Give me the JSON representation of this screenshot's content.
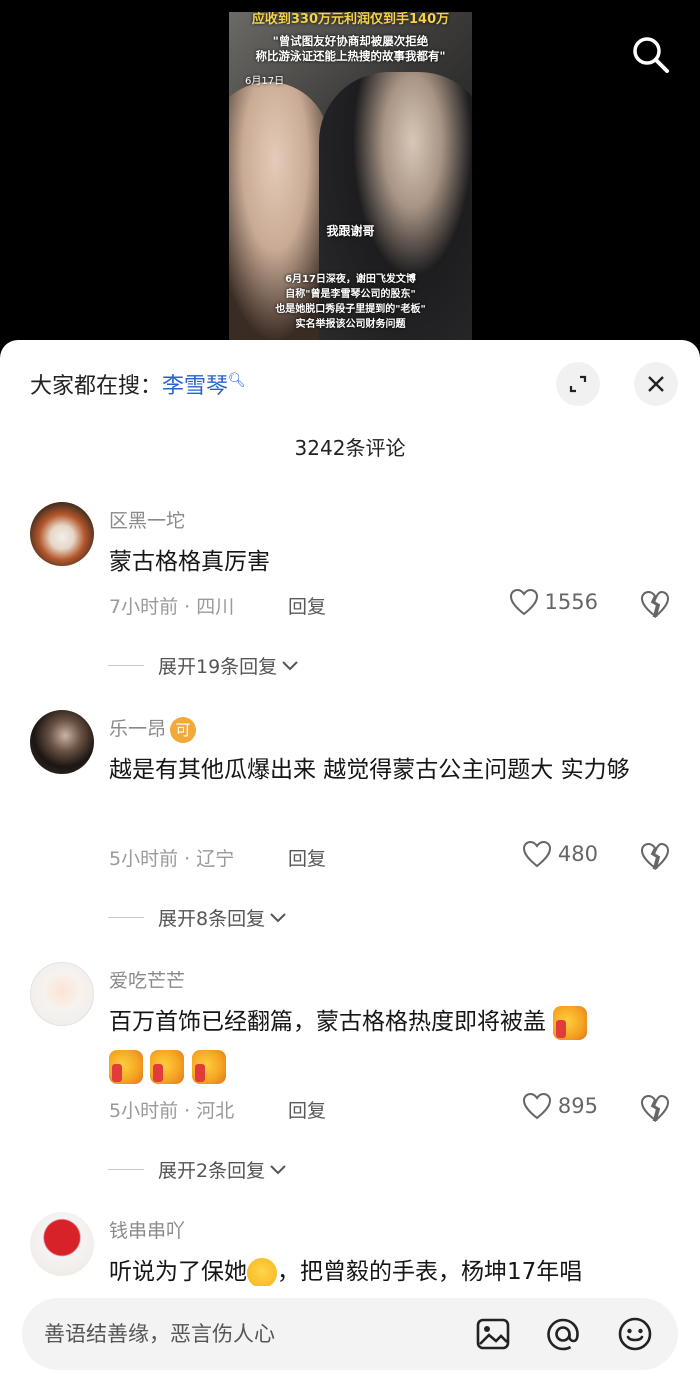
{
  "video": {
    "headline": "应收到330万元利润仅到手140万",
    "subtitle_lines": [
      "\"曾试图友好协商却被屡次拒绝",
      "称比游泳证还能上热搜的故事我都有\""
    ],
    "date": "6月17日",
    "caption": "我跟谢哥",
    "story_lines": [
      "6月17日深夜，谢田飞发文博",
      "自称\"曾是李雪琴公司的股东\"",
      "也是她脱口秀段子里提到的\"老板\"",
      "实名举报该公司财务问题"
    ]
  },
  "search_hint": {
    "prefix": "大家都在搜：",
    "keyword": "李雪琴"
  },
  "comments_title": "3242条评论",
  "comments": [
    {
      "user": "区黑一坨",
      "text": "蒙古格格真厉害",
      "time": "7小时前 · 四川",
      "reply": "回复",
      "likes": "1556",
      "expand": "展开19条回复"
    },
    {
      "user": "乐一昂",
      "badge": "可",
      "text": "越是有其他瓜爆出来 越觉得蒙古公主问题大  实力够",
      "time": "5小时前 · 辽宁",
      "reply": "回复",
      "likes": "480",
      "expand": "展开8条回复"
    },
    {
      "user": "爱吃芒芒",
      "text": "百万首饰已经翻篇，蒙古格格热度即将被盖",
      "time": "5小时前 · 河北",
      "reply": "回复",
      "likes": "895",
      "expand": "展开2条回复"
    },
    {
      "user": "钱串串吖",
      "text": "听说为了保她",
      "text_tail": "，把曾毅的手表，杨坤17年唱"
    }
  ],
  "input": {
    "placeholder": "善语结善缘，恶言伤人心"
  },
  "icons": {
    "search": "search-icon",
    "fullscreen": "fullscreen-icon",
    "close": "close-icon",
    "like": "heart-icon",
    "dislike": "broken-heart-icon",
    "image": "image-icon",
    "mention": "at-icon",
    "emoji": "emoji-icon"
  },
  "colors": {
    "link": "#2b62c9",
    "badge": "#f2a93b"
  }
}
